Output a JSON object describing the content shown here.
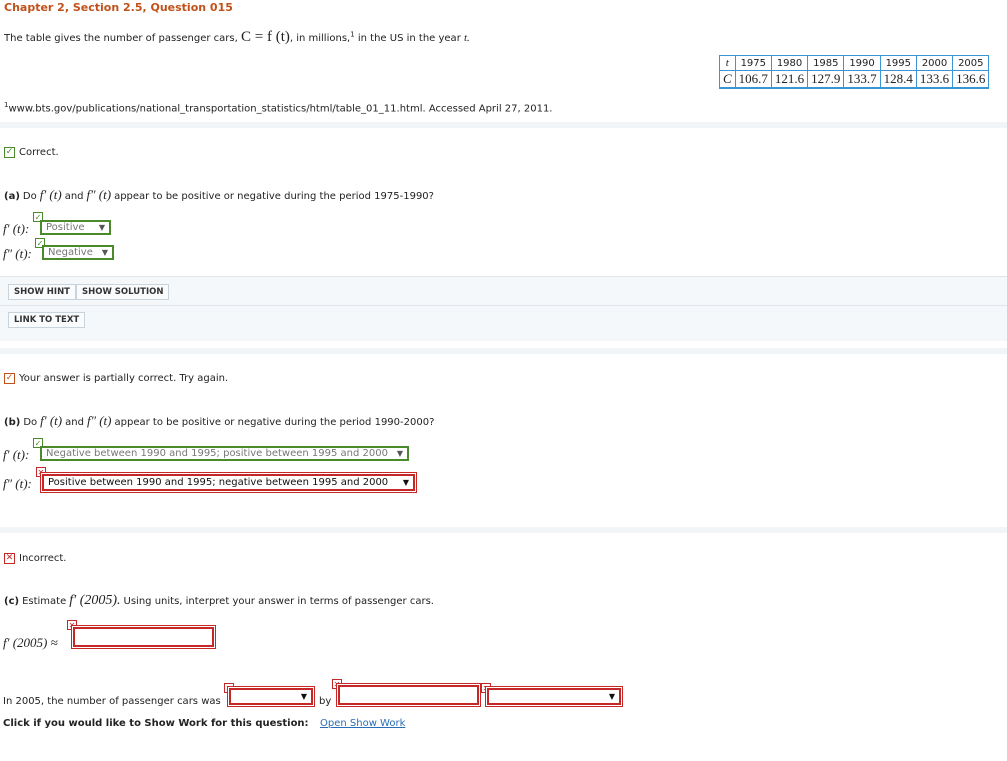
{
  "header": {
    "title": "Chapter 2, Section 2.5, Question 015",
    "intro_prefix": "The table gives the number of passenger cars,",
    "intro_math": "C = f (t)",
    "intro_mid": ", in millions,",
    "intro_sup": "1",
    "intro_suffix": "in the US in the year",
    "intro_var": "t.",
    "footnote_sup": "1",
    "footnote": "www.bts.gov/publications/national_transportation_statistics/html/table_01_11.html. Accessed April 27, 2011."
  },
  "table": {
    "row1_label": "t",
    "row2_label": "C",
    "years": [
      "1975",
      "1980",
      "1985",
      "1990",
      "1995",
      "2000",
      "2005"
    ],
    "values": [
      "106.7",
      "121.6",
      "127.9",
      "133.7",
      "128.4",
      "133.6",
      "136.6"
    ]
  },
  "part_a": {
    "status": "Correct.",
    "label": "(a)",
    "q_do": "Do",
    "q_fp": "f′ (t)",
    "q_and": "and",
    "q_fpp": "f″ (t)",
    "q_rest": "appear to be positive or negative during the period 1975-1990?",
    "fp_label": "f′ (t):",
    "fpp_label": "f″ (t):",
    "fp_value": "Positive",
    "fpp_value": "Negative"
  },
  "hints": {
    "show_hint": "SHOW HINT",
    "show_solution": "SHOW SOLUTION",
    "link_to_text": "LINK TO TEXT"
  },
  "part_b": {
    "status": "Your answer is partially correct.  Try again.",
    "label": "(b)",
    "q_do": "Do",
    "q_fp": "f′ (t)",
    "q_and": "and",
    "q_fpp": "f″ (t)",
    "q_rest": "appear to be positive or negative during the period 1990-2000?",
    "fp_label": "f′ (t):",
    "fpp_label": "f″ (t):",
    "fp_value": "Negative between 1990 and 1995; positive between 1995 and 2000",
    "fpp_value": "Positive between 1990 and 1995; negative between 1995 and 2000"
  },
  "part_c": {
    "status": "Incorrect.",
    "label": "(c)",
    "q_estimate": "Estimate",
    "q_math": "f′ (2005).",
    "q_rest": "Using units, interpret your answer in terms of passenger cars.",
    "approx_label": "f′ (2005) ≈",
    "sentence_prefix": "In 2005, the number of passenger cars was",
    "by": "by",
    "show_work_prompt": "Click if you would like to Show Work for this question:",
    "open_show_work": "Open Show Work"
  },
  "icons": {
    "check": "✓",
    "cross": "✕",
    "partial": "✓",
    "dropdown": "▼"
  },
  "colors": {
    "title": "#c0511a",
    "correct": "#4a8a2a",
    "incorrect": "#c62828",
    "table_border": "#3b95d6",
    "link": "#2a6db6"
  }
}
